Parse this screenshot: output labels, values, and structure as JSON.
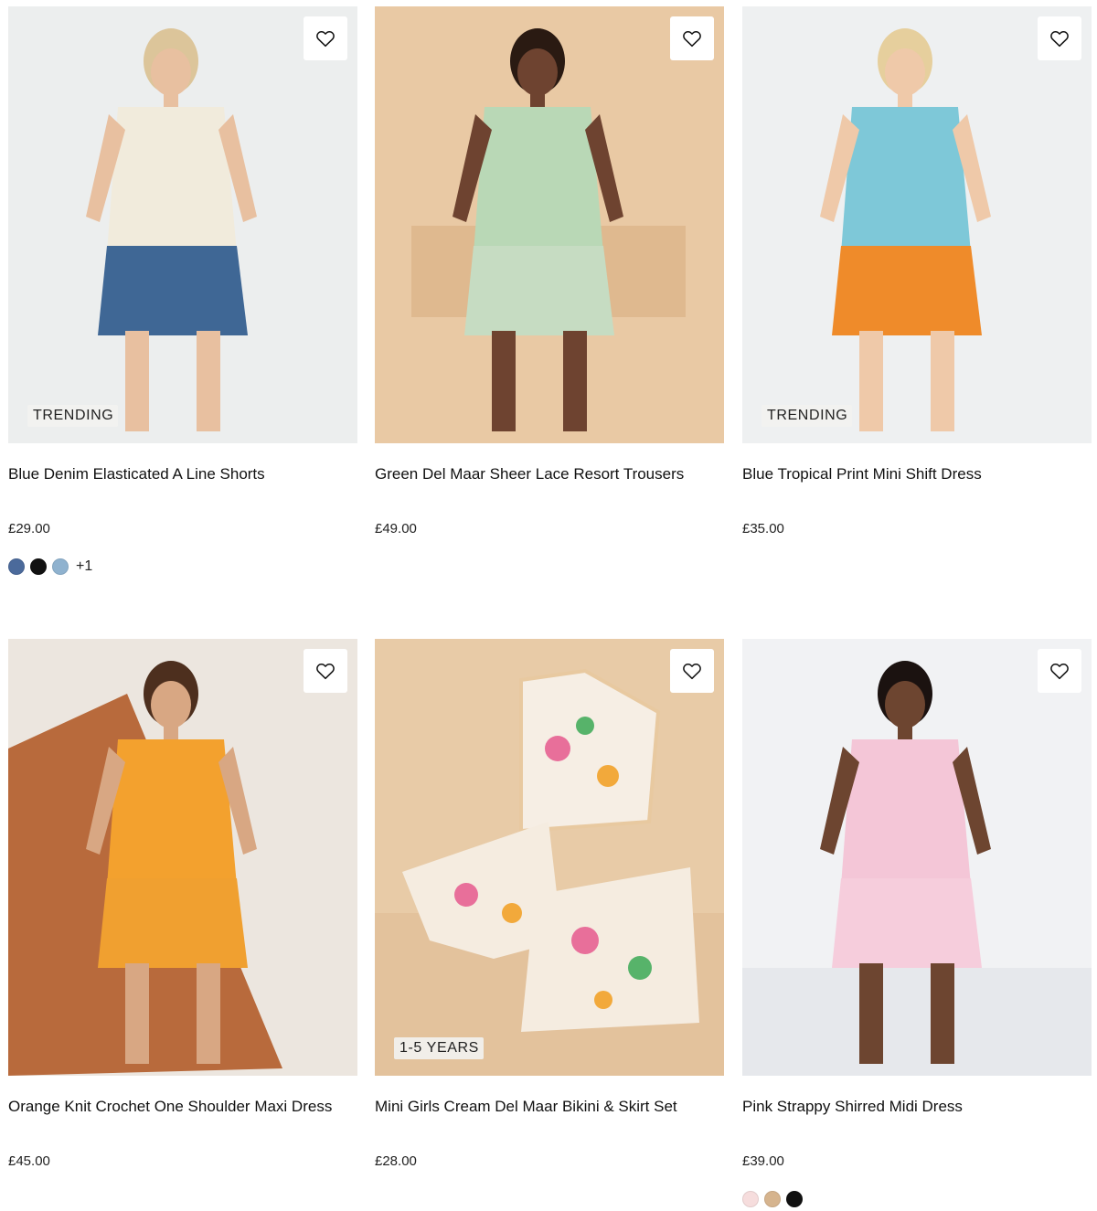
{
  "products": [
    {
      "title": "Blue Denim Elasticated A Line Shorts",
      "price": "£29.00",
      "badge": "TRENDING",
      "swatches": [
        "#4b6a9b",
        "#111111",
        "#8fb2cf"
      ],
      "more_colours": "+1",
      "image_colors": {
        "bg": "#eceeee",
        "top": "#f1ebdc",
        "bottom": "#3f6795",
        "skin": "#e8c0a0",
        "hair": "#dcc59a"
      }
    },
    {
      "title": "Green Del Maar Sheer Lace Resort Trousers",
      "price": "£49.00",
      "badge": "",
      "swatches": [],
      "more_colours": "",
      "image_colors": {
        "bg": "#e9c9a4",
        "top": "#b9d8b6",
        "bottom": "#c6dcc2",
        "skin": "#6e4330",
        "hair": "#2a1a12"
      }
    },
    {
      "title": "Blue Tropical Print Mini Shift Dress",
      "price": "£35.00",
      "badge": "TRENDING",
      "swatches": [],
      "more_colours": "",
      "image_colors": {
        "bg": "#eef0f1",
        "top": "#7ec8d8",
        "bottom": "#ef8b2a",
        "skin": "#efc9a9",
        "hair": "#e6cf9d"
      }
    },
    {
      "title": "Orange Knit Crochet One Shoulder Maxi Dress",
      "price": "£45.00",
      "badge": "",
      "swatches": [],
      "more_colours": "",
      "image_colors": {
        "bg": "#ece6df",
        "top": "#f3a12e",
        "bottom": "#f0a030",
        "skin": "#d8a783",
        "hair": "#4d2f1e"
      }
    },
    {
      "title": "Mini Girls Cream Del Maar Bikini & Skirt Set",
      "price": "£28.00",
      "badge": "1-5 YEARS",
      "swatches": [],
      "more_colours": "",
      "image_colors": {
        "bg": "#e8cba7",
        "top": "#f6eee4",
        "bottom": "#f5ece0",
        "skin": "#e86f9a",
        "hair": "#57b36a"
      }
    },
    {
      "title": "Pink Strappy Shirred Midi Dress",
      "price": "£39.00",
      "badge": "",
      "swatches": [
        "#f6dddd",
        "#d6b48e",
        "#111111"
      ],
      "more_colours": "",
      "image_colors": {
        "bg": "#f1f2f4",
        "top": "#f4c6d7",
        "bottom": "#f6cddc",
        "skin": "#6d4530",
        "hair": "#1b1210"
      }
    }
  ]
}
